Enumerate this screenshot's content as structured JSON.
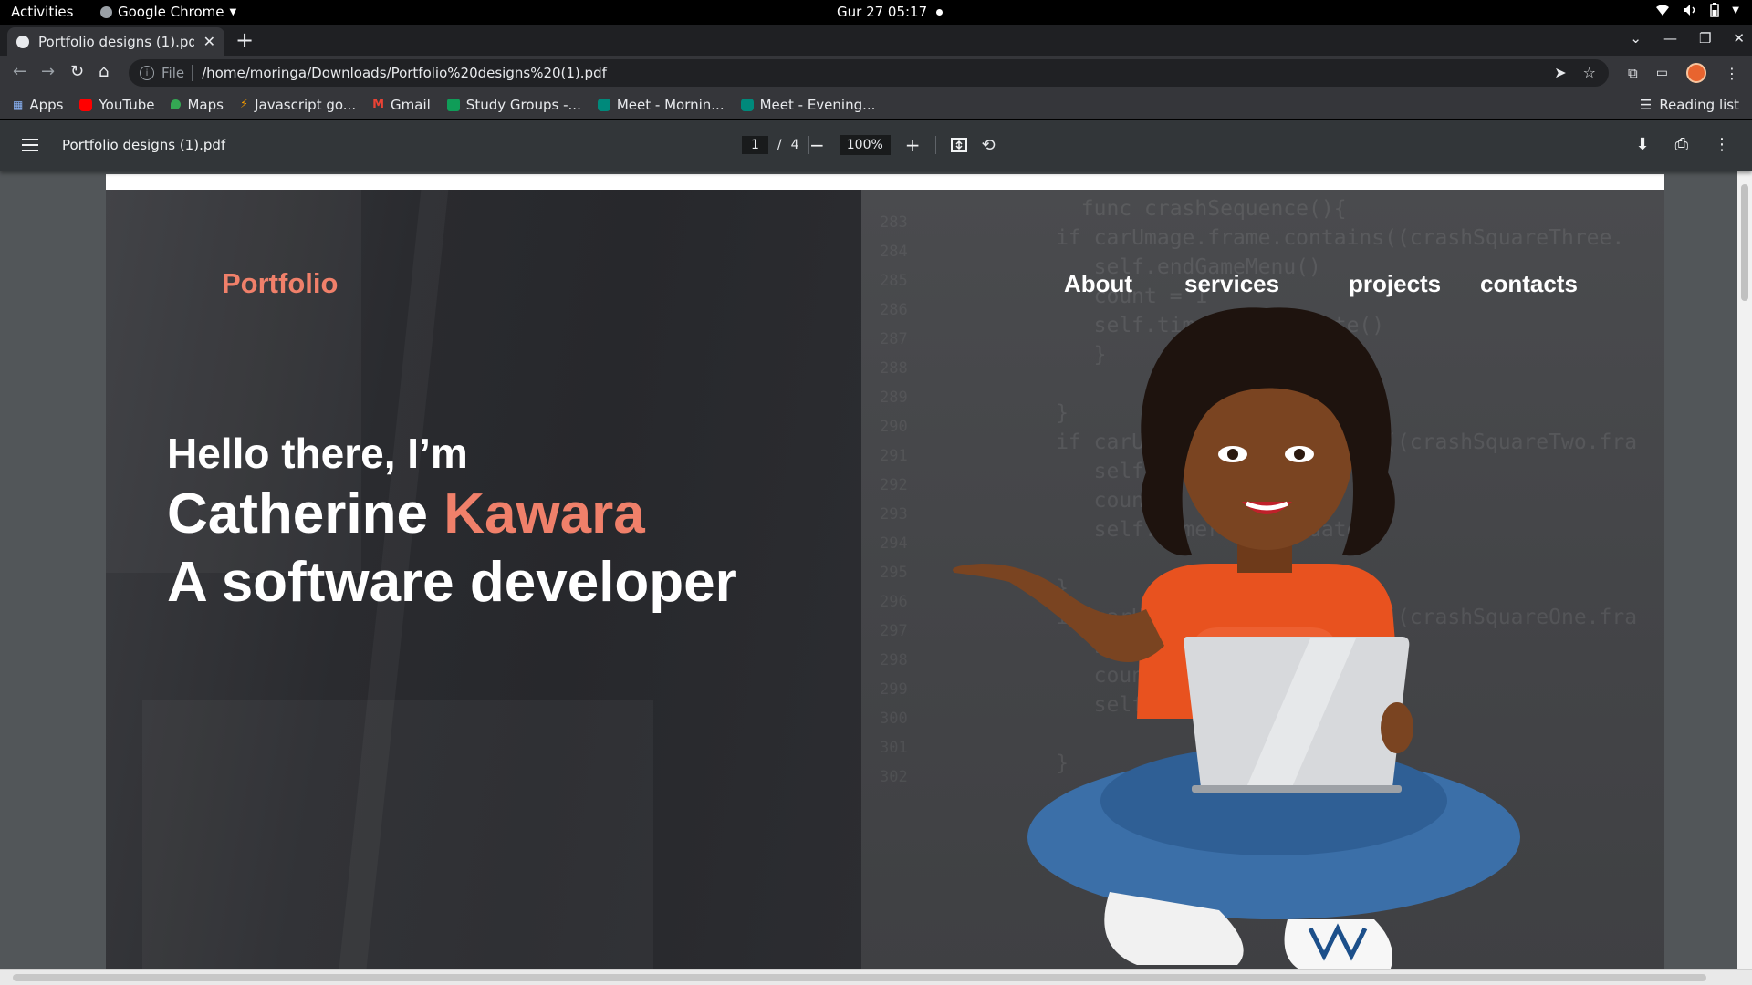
{
  "system": {
    "activities": "Activities",
    "app_name": "Google Chrome",
    "clock": "Gur 27  05:17"
  },
  "browser": {
    "tab_title": "Portfolio designs (1).pdf",
    "address_scheme": "File",
    "address_url": "/home/moringa/Downloads/Portfolio%20designs%20(1).pdf",
    "bookmarks": [
      {
        "label": "Apps",
        "color": "#8ab4f8"
      },
      {
        "label": "YouTube",
        "color": "#ff0000"
      },
      {
        "label": "Maps",
        "color": "#34a853"
      },
      {
        "label": "Javascript go...",
        "color": "#f29900"
      },
      {
        "label": "Gmail",
        "color": "#ea4335"
      },
      {
        "label": "Study Groups -...",
        "color": "#0f9d58"
      },
      {
        "label": "Meet - Mornin...",
        "color": "#00897b"
      },
      {
        "label": "Meet - Evening...",
        "color": "#00897b"
      }
    ],
    "reading_list": "Reading list"
  },
  "pdf_viewer": {
    "file_title": "Portfolio designs (1).pdf",
    "current_page": "1",
    "page_separator": "/",
    "total_pages": "4",
    "zoom": "100%"
  },
  "document": {
    "logo": "Portfolio",
    "nav": [
      "About",
      "services",
      "projects",
      "contacts"
    ],
    "greeting": "Hello there, I’m",
    "first_name": "Catherine",
    "last_name": "Kawara",
    "role": "A software developer",
    "accent_color": "#f0806a"
  }
}
